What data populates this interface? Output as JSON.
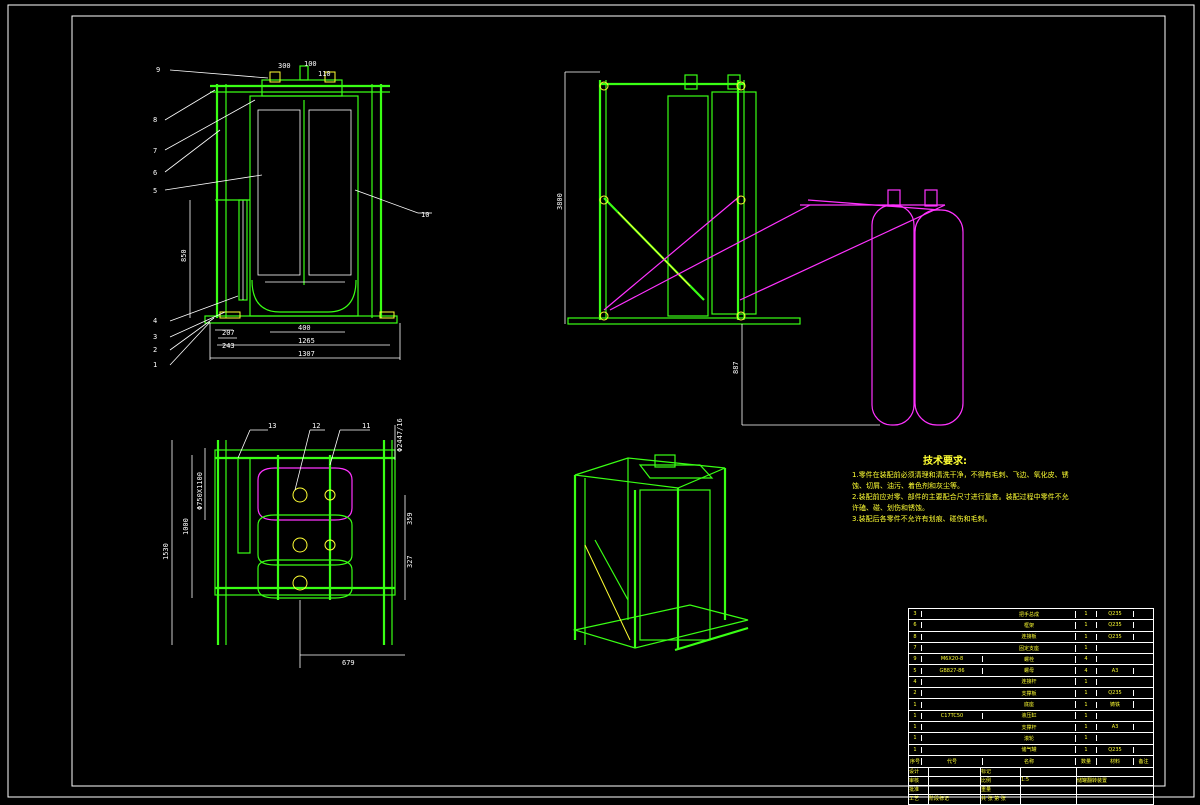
{
  "colors": {
    "background": "#000000",
    "frame": "#ffffff",
    "structure": "#39ff14",
    "alt_position": "#ff33ff",
    "text": "#ffff33"
  },
  "part_callouts": [
    "9",
    "8",
    "7",
    "6",
    "5",
    "4",
    "3",
    "2",
    "1",
    "10"
  ],
  "top_view_callouts": [
    "13",
    "12",
    "11"
  ],
  "front_view_dimensions": {
    "dim_top_a": "300",
    "dim_top_b": "100",
    "dim_top_c": "110",
    "dim_height": "850",
    "dim_400": "400",
    "dim_bottom_a": "207",
    "dim_bottom_b": "1265",
    "dim_total": "1307",
    "dim_small": "243"
  },
  "side_view_dimensions": {
    "dim_height": "3800",
    "dim_drop": "887"
  },
  "top_view_dimensions": {
    "dim_1530": "1530",
    "dim_1000": "1000",
    "dim_phi": "Φ750X1100",
    "dim_359": "359",
    "dim_327": "327",
    "dim_679": "679",
    "dim_top_right": "Φ2447/16"
  },
  "tech_requirements": {
    "title": "技术要求:",
    "items": [
      "1.零件在装配前必须清理和清洗干净，不得有毛刺、飞边、氧化皮、锈蚀、切屑、油污、着色剂和灰尘等。",
      "2.装配前应对零、部件的主要配合尺寸进行复查。装配过程中零件不允许磕、碰、划伤和锈蚀。",
      "3.装配后各零件不允许有划痕、碰伤和毛刺。"
    ]
  },
  "bom_rows": [
    {
      "no": "3",
      "code": "",
      "name": "把手总成",
      "qty": "1",
      "material": "Q235"
    },
    {
      "no": "6",
      "code": "",
      "name": "框架",
      "qty": "1",
      "material": "Q235"
    },
    {
      "no": "8",
      "code": "",
      "name": "连接板",
      "qty": "1",
      "material": "Q235"
    },
    {
      "no": "7",
      "code": "",
      "name": "固定支座",
      "qty": "1",
      "material": ""
    },
    {
      "no": "9",
      "code": "M6X20-8",
      "name": "螺栓",
      "qty": "4",
      "material": ""
    },
    {
      "no": "5",
      "code": "GB827-86",
      "name": "螺母",
      "qty": "4",
      "material": "A3"
    },
    {
      "no": "4",
      "code": "",
      "name": "连接杆",
      "qty": "1",
      "material": ""
    },
    {
      "no": "2",
      "code": "",
      "name": "支撑板",
      "qty": "1",
      "material": "Q235"
    },
    {
      "no": "1",
      "code": "",
      "name": "底座",
      "qty": "1",
      "material": "铸铁"
    },
    {
      "no": "1",
      "code": "C17TC50",
      "name": "液压缸",
      "qty": "1",
      "material": ""
    },
    {
      "no": "1",
      "code": "",
      "name": "支撑杆",
      "qty": "1",
      "material": "A3"
    },
    {
      "no": "1",
      "code": "",
      "name": "滚轮",
      "qty": "1",
      "material": ""
    },
    {
      "no": "1",
      "code": "",
      "name": "储气罐",
      "qty": "1",
      "material": "Q235"
    }
  ],
  "bom_header": {
    "no": "序号",
    "code": "代号",
    "name": "名称",
    "qty": "数量",
    "material": "材料",
    "remark": "备注"
  },
  "title_block": {
    "design": "设计",
    "check": "审核",
    "approve": "批准",
    "process": "工艺",
    "scale_label": "比例",
    "scale_value": "1:5",
    "sheet": "共 张 第 张",
    "drawing_title": "储罐翻转装置",
    "row_a": "标记",
    "row_b": "处数",
    "row_c": "分区",
    "row_d": "更改文件号",
    "row_e": "签名",
    "row_f": "年月日",
    "misc": "阶段标记",
    "weight": "重量"
  }
}
